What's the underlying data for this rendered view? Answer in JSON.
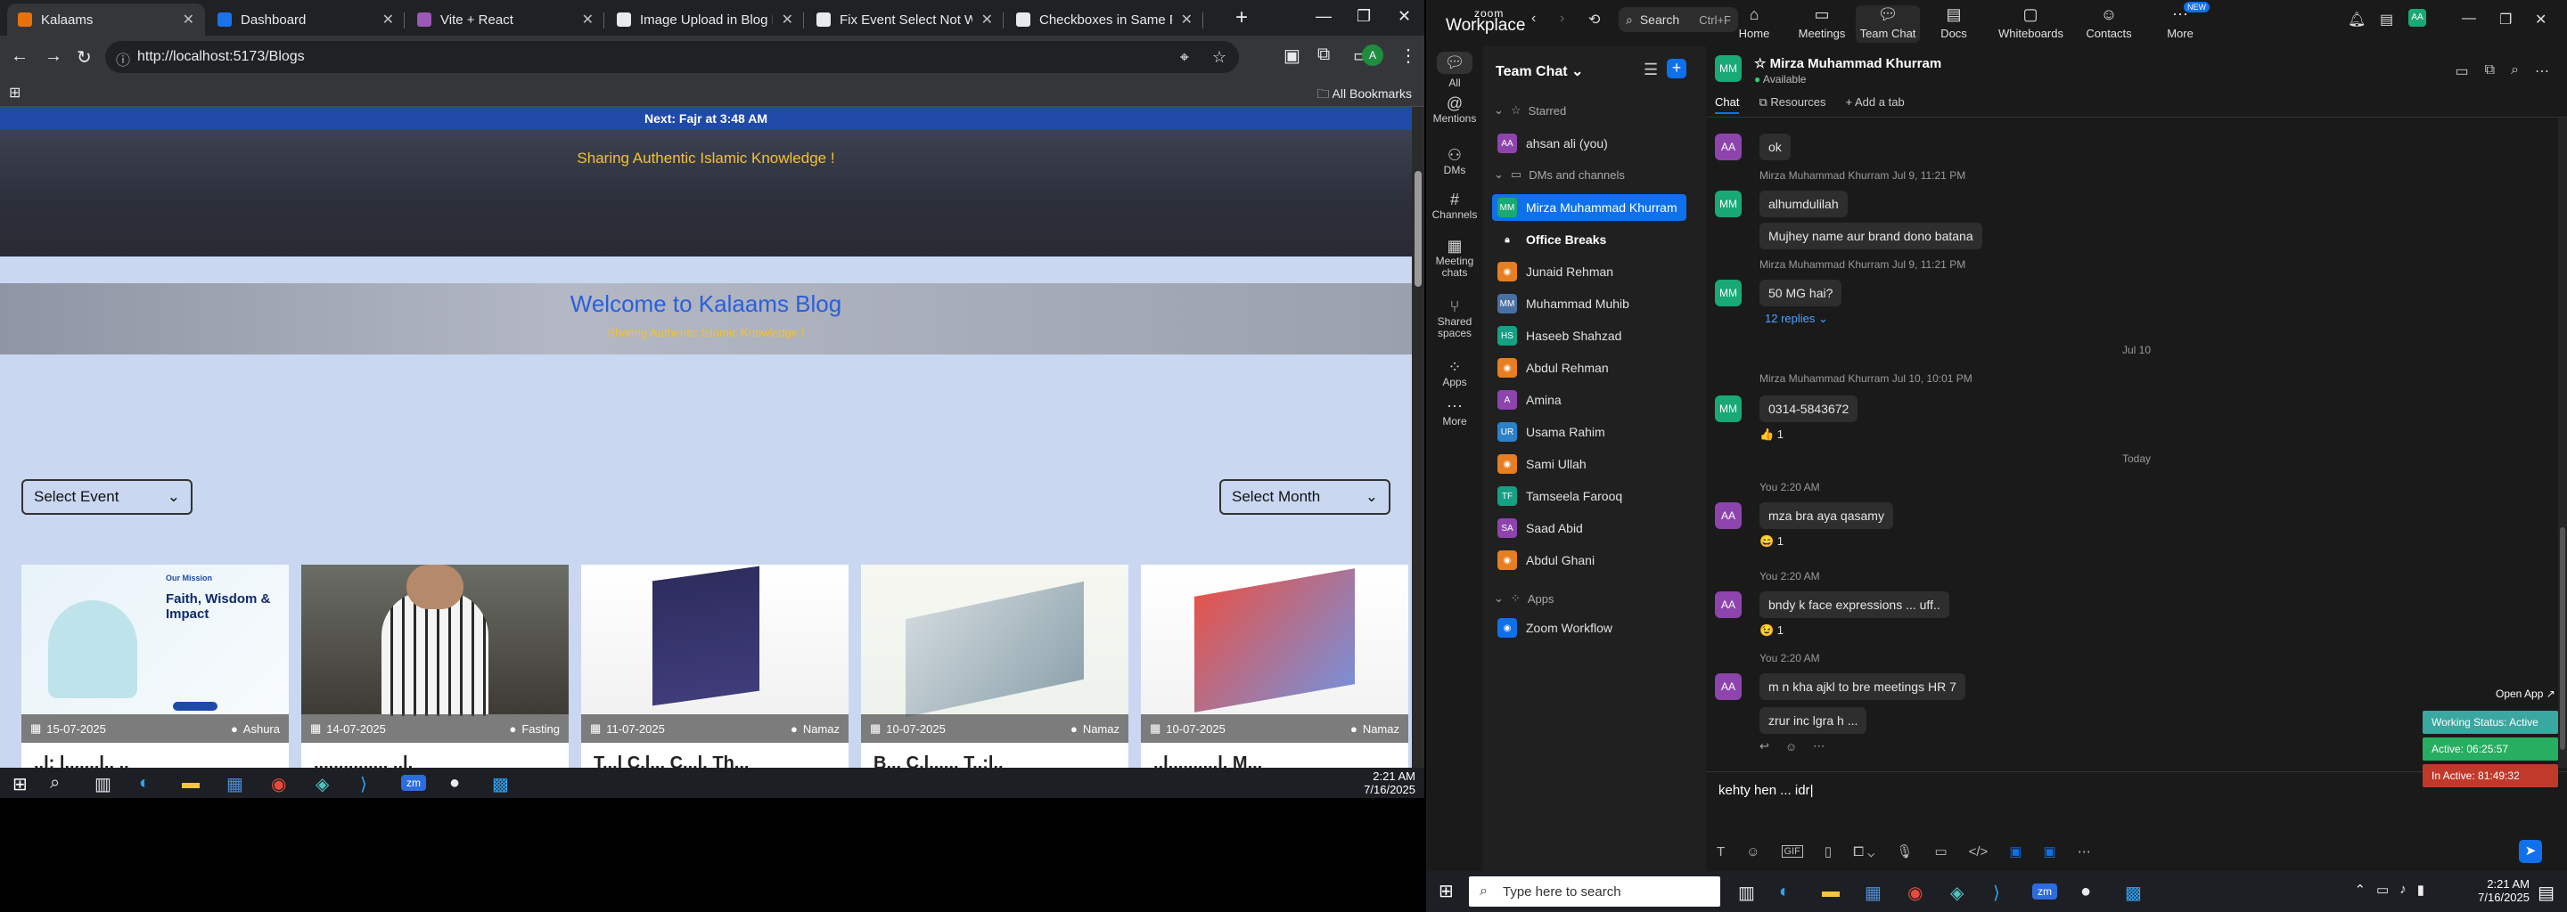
{
  "browser": {
    "tabs": [
      {
        "title": "Kalaams",
        "active": true,
        "color": "#e8710a"
      },
      {
        "title": "Dashboard",
        "active": false,
        "color": "#1a73e8"
      },
      {
        "title": "Vite + React",
        "active": false,
        "color": "#9b59b6"
      },
      {
        "title": "Image Upload in Blog Editor",
        "active": false,
        "color": "#e8eaed"
      },
      {
        "title": "Fix Event Select Not Working",
        "active": false,
        "color": "#e8eaed"
      },
      {
        "title": "Checkboxes in Same Row",
        "active": false,
        "color": "#e8eaed"
      }
    ],
    "url": "http://localhost:5173/Blogs",
    "all_bookmarks": "All Bookmarks"
  },
  "page": {
    "prayer": "Next: Fajr at 3:48 AM",
    "tagline": "Sharing Authentic Islamic Knowledge !",
    "welcome": "Welcome to Kalaams Blog",
    "tagline2": "Sharing Authentic Islamic Knowledge !",
    "select_event": "Select Event",
    "select_month": "Select Month",
    "cards": [
      {
        "date": "15-07-2025",
        "category": "Ashura",
        "title": "..l: l.......l.. ..",
        "mission": "Our Mission",
        "heading": "Faith, Wisdom & Impact"
      },
      {
        "date": "14-07-2025",
        "category": "Fasting",
        "title": "............... ..l."
      },
      {
        "date": "11-07-2025",
        "category": "Namaz",
        "title": "T...l C.l... C...l. Th..."
      },
      {
        "date": "10-07-2025",
        "category": "Namaz",
        "title": "B... C.l...... T..:l.."
      },
      {
        "date": "10-07-2025",
        "category": "Namaz",
        "title": "..l..........l. M..."
      }
    ]
  },
  "taskbar_left": {
    "time": "2:21 AM",
    "date": "7/16/2025"
  },
  "zoom": {
    "logo_top": "zoom",
    "logo_bottom": "Workplace",
    "search": "Search",
    "search_shortcut": "Ctrl+F",
    "nav": [
      {
        "label": "Home",
        "icon": "home-icon"
      },
      {
        "label": "Meetings",
        "icon": "camera-icon"
      },
      {
        "label": "Team Chat",
        "icon": "chat-icon",
        "active": true
      },
      {
        "label": "Docs",
        "icon": "doc-icon"
      },
      {
        "label": "Whiteboards",
        "icon": "whiteboard-icon"
      },
      {
        "label": "Contacts",
        "icon": "contacts-icon"
      },
      {
        "label": "More",
        "icon": "more-icon",
        "badge": "NEW"
      }
    ],
    "rail": [
      {
        "label": "All",
        "icon": "chat-bubble-icon",
        "active": true
      },
      {
        "label": "Mentions",
        "icon": "at-icon"
      },
      {
        "label": "DMs",
        "icon": "people-icon"
      },
      {
        "label": "Channels",
        "icon": "hash-icon"
      },
      {
        "label": "Meeting chats",
        "icon": "calendar-icon"
      },
      {
        "label": "Shared spaces",
        "icon": "share-icon"
      },
      {
        "label": "Apps",
        "icon": "apps-icon"
      },
      {
        "label": "More",
        "icon": "more-icon"
      }
    ],
    "list_header": "Team Chat",
    "starred_label": "Starred",
    "dms_label": "DMs and channels",
    "apps_label": "Apps",
    "starred": [
      {
        "name": "ahsan ali (you)",
        "initials": "AA",
        "color": "#8e44ad"
      }
    ],
    "contacts": [
      {
        "name": "Mirza Muhammad Khurram",
        "initials": "MM",
        "color": "#19a974",
        "selected": true
      },
      {
        "name": "Office Breaks",
        "initials": "",
        "color": "#202020",
        "bold": true,
        "lock": true
      },
      {
        "name": "Junaid Rehman",
        "initials": "",
        "color": "#e67e22"
      },
      {
        "name": "Muhammad Muhib",
        "initials": "MM",
        "color": "#4a6fa5"
      },
      {
        "name": "Haseeb Shahzad",
        "initials": "HS",
        "color": "#16a085"
      },
      {
        "name": "Abdul Rehman",
        "initials": "",
        "color": "#e67e22"
      },
      {
        "name": "Amina",
        "initials": "A",
        "color": "#8e44ad"
      },
      {
        "name": "Usama Rahim",
        "initials": "UR",
        "color": "#2c82c9"
      },
      {
        "name": "Sami Ullah",
        "initials": "",
        "color": "#e67e22"
      },
      {
        "name": "Tamseela Farooq",
        "initials": "TF",
        "color": "#16a085"
      },
      {
        "name": "Saad Abid",
        "initials": "SA",
        "color": "#8e44ad"
      },
      {
        "name": "Abdul Ghani",
        "initials": "",
        "color": "#e67e22"
      }
    ],
    "apps": [
      {
        "name": "Zoom Workflow",
        "initials": "",
        "color": "#0e71eb"
      }
    ],
    "chat": {
      "name": "Mirza Muhammad Khurram",
      "status": "Available",
      "tab_chat": "Chat",
      "tab_resources": "Resources",
      "tab_add": "Add a tab",
      "messages": [
        {
          "kind": "bubble",
          "text": "ok",
          "av": "AA",
          "avcolor": "#8e44ad"
        },
        {
          "kind": "meta",
          "text": "Mirza Muhammad Khurram  Jul 9, 11:21 PM"
        },
        {
          "kind": "bubble",
          "text": "alhumdulilah",
          "av": "MM",
          "avcolor": "#19a974"
        },
        {
          "kind": "bubble",
          "text": "Mujhey name aur brand dono batana"
        },
        {
          "kind": "meta",
          "text": "Mirza Muhammad Khurram  Jul 9, 11:21 PM"
        },
        {
          "kind": "bubble",
          "text": "50 MG hai?",
          "av": "MM",
          "avcolor": "#19a974"
        },
        {
          "kind": "replies",
          "text": "12 replies ⌄"
        },
        {
          "kind": "day",
          "text": "Jul 10"
        },
        {
          "kind": "meta",
          "text": "Mirza Muhammad Khurram  Jul 10, 10:01 PM"
        },
        {
          "kind": "bubble",
          "text": "0314-5843672",
          "av": "MM",
          "avcolor": "#19a974"
        },
        {
          "kind": "react",
          "text": "👍 1"
        },
        {
          "kind": "day",
          "text": "Today"
        },
        {
          "kind": "meta",
          "text": "You  2:20 AM"
        },
        {
          "kind": "bubble",
          "text": "mza bra aya qasamy",
          "av": "AA",
          "avcolor": "#8e44ad"
        },
        {
          "kind": "react",
          "text": "😄 1"
        },
        {
          "kind": "meta",
          "text": "You  2:20 AM"
        },
        {
          "kind": "bubble",
          "text": "bndy k face expressions ... uff..",
          "av": "AA",
          "avcolor": "#8e44ad"
        },
        {
          "kind": "react",
          "text": "😉 1"
        },
        {
          "kind": "meta",
          "text": "You  2:20 AM"
        },
        {
          "kind": "bubble",
          "text": "m n kha ajkl to bre meetings HR 7",
          "av": "AA",
          "avcolor": "#8e44ad"
        },
        {
          "kind": "bubble",
          "text": "zrur inc lgra h ..."
        }
      ],
      "compose_text": "kehty hen ... idr"
    },
    "open_app": "Open App ↗",
    "work_status": "Working Status: Active",
    "active_time": "Active: 06:25:57",
    "inactive_time": "In Active: 81:49:32"
  },
  "taskbar_right": {
    "search_placeholder": "Type here to search",
    "time": "2:21 AM",
    "date": "7/16/2025"
  }
}
